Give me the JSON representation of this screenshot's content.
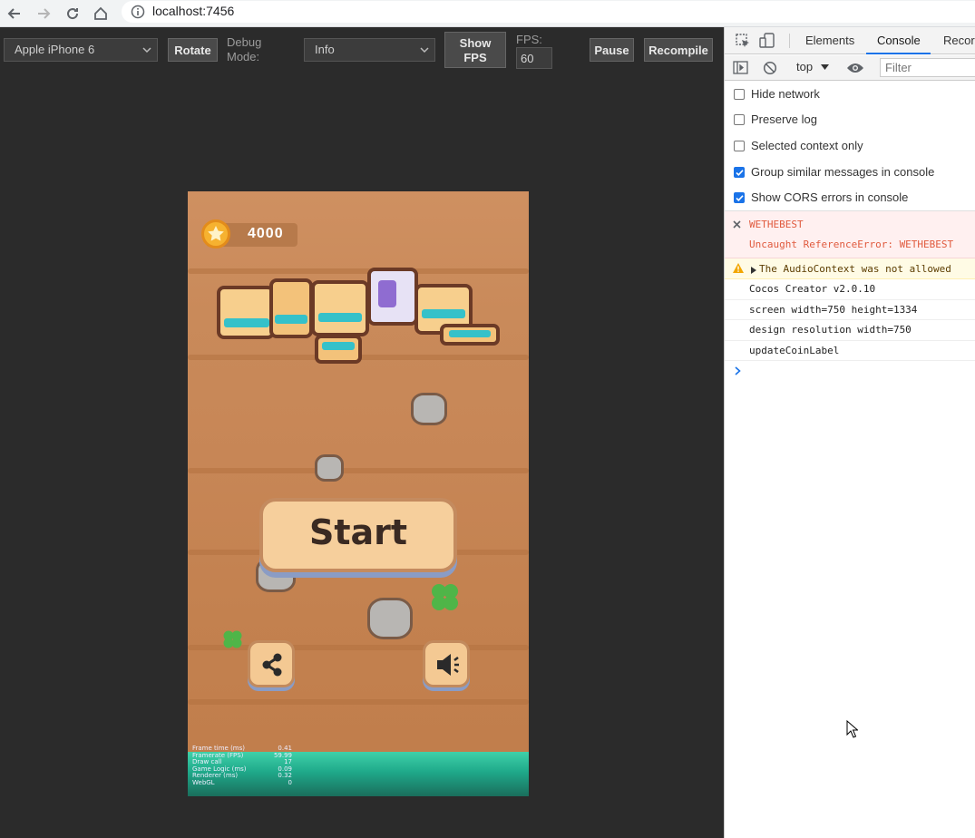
{
  "browser": {
    "url": "localhost:7456"
  },
  "toolbar": {
    "device_select": "Apple iPhone 6",
    "rotate_label": "Rotate",
    "debug_mode_label": "Debug Mode:",
    "debug_select": "Info",
    "show_fps_label": "Show FPS",
    "fps_label": "FPS:",
    "fps_value": "60",
    "pause_label": "Pause",
    "recompile_label": "Recompile"
  },
  "game": {
    "coins": "4000",
    "start_label": "Start",
    "stats": [
      {
        "label": "Frame time (ms)",
        "value": "0.41"
      },
      {
        "label": "Framerate (FPS)",
        "value": "59.99"
      },
      {
        "label": "Draw call",
        "value": "17"
      },
      {
        "label": "Game Logic (ms)",
        "value": "0.09"
      },
      {
        "label": "Renderer (ms)",
        "value": "0.32"
      },
      {
        "label": "WebGL",
        "value": "0"
      }
    ]
  },
  "devtools": {
    "tabs": [
      "Elements",
      "Console",
      "Recorder"
    ],
    "active_tab": "Console",
    "context": "top",
    "filter_placeholder": "Filter",
    "options": [
      {
        "label": "Hide network",
        "checked": false
      },
      {
        "label": "Preserve log",
        "checked": false
      },
      {
        "label": "Selected context only",
        "checked": false
      },
      {
        "label": "Group similar messages in console",
        "checked": true
      },
      {
        "label": "Show CORS errors in console",
        "checked": true
      }
    ],
    "messages": [
      {
        "type": "error",
        "lines": [
          "WETHEBEST",
          "Uncaught ReferenceError: WETHEBEST"
        ]
      },
      {
        "type": "warning",
        "lines": [
          "The AudioContext was not allowed"
        ]
      },
      {
        "type": "log",
        "lines": [
          "Cocos Creator v2.0.10"
        ]
      },
      {
        "type": "log",
        "lines": [
          "screen width=750 height=1334"
        ]
      },
      {
        "type": "log",
        "lines": [
          "design resolution width=750"
        ]
      },
      {
        "type": "log",
        "lines": [
          "updateCoinLabel"
        ]
      }
    ]
  },
  "colors": {
    "error_bg": "#fff0f0",
    "error_text": "#e05a3e",
    "warning_bg": "#fffbe5",
    "warning_text": "#5c3c00",
    "accent": "#1a73e8"
  }
}
